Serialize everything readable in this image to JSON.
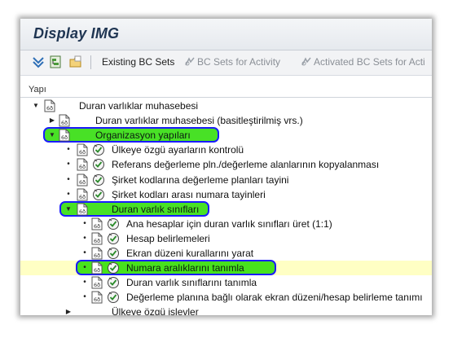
{
  "title": "Display IMG",
  "toolbar": {
    "icons": [
      "expand-all-icon",
      "structure-icon",
      "folder-icon"
    ],
    "existing_bc_sets": "Existing BC Sets",
    "bc_sets_for_activity": "BC Sets for Activity",
    "activated_bc_sets": "Activated BC Sets for Acti"
  },
  "tree": {
    "header": "Yapı",
    "rows": [
      {
        "label": "Duran varlıklar muhasebesi",
        "level": 0,
        "expander": "down",
        "icons": [
          "img-doc-icon"
        ],
        "highlight": false
      },
      {
        "label": "Duran varlıklar muhasebesi (basitleştirilmiş vrs.)",
        "level": 1,
        "expander": "right",
        "icons": [
          "img-doc-icon"
        ],
        "highlight": false
      },
      {
        "label": "Organizasyon yapıları",
        "level": 1,
        "expander": "down",
        "icons": [
          "img-doc-icon"
        ],
        "highlight": true
      },
      {
        "label": "Ülkeye özgü ayarların kontrolü",
        "level": 2,
        "expander": "bullet",
        "icons": [
          "img-doc-icon",
          "execute-activity-icon"
        ],
        "highlight": false
      },
      {
        "label": "Referans değerleme pln./değerleme alanlarının kopyalanması",
        "level": 2,
        "expander": "bullet",
        "icons": [
          "img-doc-icon",
          "execute-activity-icon"
        ],
        "highlight": false
      },
      {
        "label": "Şirket kodlarına değerleme planları tayini",
        "level": 2,
        "expander": "bullet",
        "icons": [
          "img-doc-icon",
          "execute-activity-icon"
        ],
        "highlight": false
      },
      {
        "label": "Şirket kodları arası numara tayinleri",
        "level": 2,
        "expander": "bullet",
        "icons": [
          "img-doc-icon",
          "execute-activity-icon"
        ],
        "highlight": false
      },
      {
        "label": "Duran varlık sınıfları",
        "level": 2,
        "expander": "down",
        "icons": [
          "img-doc-icon"
        ],
        "highlight": true
      },
      {
        "label": "Ana hesaplar için duran varlık sınıfları üret (1:1)",
        "level": 3,
        "expander": "bullet",
        "icons": [
          "img-doc-icon",
          "execute-activity-icon"
        ],
        "highlight": false
      },
      {
        "label": "Hesap belirlemeleri",
        "level": 3,
        "expander": "bullet",
        "icons": [
          "img-doc-icon",
          "execute-activity-icon"
        ],
        "highlight": false
      },
      {
        "label": "Ekran düzeni kurallarını yarat",
        "level": 3,
        "expander": "bullet",
        "icons": [
          "img-doc-icon",
          "execute-activity-icon"
        ],
        "highlight": false
      },
      {
        "label": "Numara aralıklarını tanımla",
        "level": 3,
        "expander": "bullet",
        "icons": [
          "img-doc-icon",
          "execute-activity-icon"
        ],
        "highlight": true,
        "selected": true
      },
      {
        "label": "Duran varlık sınıflarını tanımla",
        "level": 3,
        "expander": "bullet",
        "icons": [
          "img-doc-icon",
          "execute-activity-icon"
        ],
        "highlight": false
      },
      {
        "label": "Değerleme planına bağlı olarak ekran düzeni/hesap belirleme tanımı",
        "level": 3,
        "expander": "bullet",
        "icons": [
          "img-doc-icon",
          "execute-activity-icon"
        ],
        "highlight": false
      },
      {
        "label": "Ülkeye özgü işlevler",
        "level": 2,
        "expander": "right",
        "icons": [],
        "highlight": false
      }
    ]
  },
  "colors": {
    "highlight_fill": "#28dc00",
    "highlight_border": "#1a1aff",
    "selected_row": "#ffffc4",
    "title_text": "#1f3552"
  }
}
